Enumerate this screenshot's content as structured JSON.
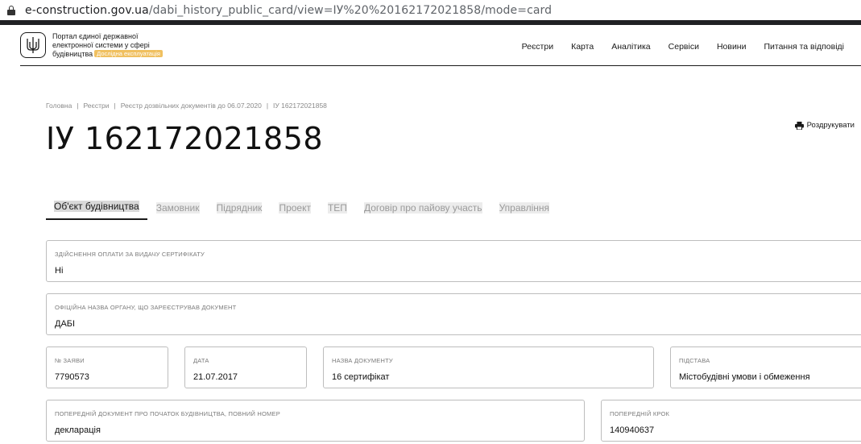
{
  "browser": {
    "url_domain": "e-construction.gov.ua",
    "url_path": "/dabi_history_public_card/view=ІУ%20%20162172021858/mode=card"
  },
  "header": {
    "brand_line1": "Портал єдиної державної",
    "brand_line2": "електронної системи у сфері",
    "brand_line3": "будівництва",
    "badge": "Дослідна експлуатація",
    "nav": [
      "Реєстри",
      "Карта",
      "Аналітика",
      "Сервіси",
      "Новини",
      "Питання та відповіді"
    ]
  },
  "breadcrumb": [
    "Головна",
    "Реєстри",
    "Реєстр дозвільних документів до 06.07.2020",
    "ІУ 162172021858"
  ],
  "page_title": "ІУ 162172021858",
  "print_label": "Роздрукувати",
  "tabs": [
    "Об'єкт будівництва",
    "Замовник",
    "Підрядник",
    "Проект",
    "ТЕП",
    "Договір про пайову участь",
    "Управління"
  ],
  "fields": {
    "payment": {
      "label": "Здійснення оплати за видачу сертифікату",
      "value": "Ні"
    },
    "authority": {
      "label": "Офіційна назва органу, що зареєстрував документ",
      "value": "ДАБІ"
    },
    "app_no": {
      "label": "№ заяви",
      "value": "7790573"
    },
    "date": {
      "label": "Дата",
      "value": "21.07.2017"
    },
    "doc_name": {
      "label": "Назва документу",
      "value": "16 сертифікат"
    },
    "basis": {
      "label": "Підстава",
      "value": "Містобудівні умови і обмеження"
    },
    "prev_doc": {
      "label": "Попередній документ про початок будівництва, повний номер",
      "value": "декларація"
    },
    "prev_step": {
      "label": "Попередній крок",
      "value": "140940637"
    }
  }
}
